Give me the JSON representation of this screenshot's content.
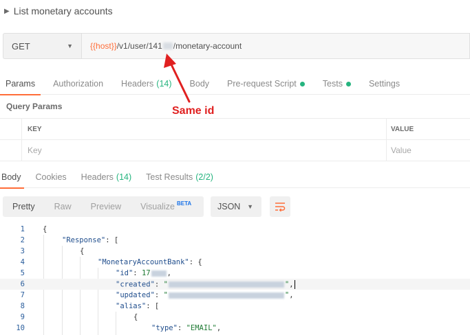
{
  "title": {
    "chevron": "▶",
    "text": "List monetary accounts"
  },
  "request": {
    "method": "GET",
    "url_var": "{{host}}",
    "url_mid": "/v1/user/141",
    "url_end": "/monetary-account"
  },
  "request_tabs": [
    {
      "label": "Params"
    },
    {
      "label": "Authorization"
    },
    {
      "label": "Headers",
      "count": "(14)"
    },
    {
      "label": "Body"
    },
    {
      "label": "Pre-request Script"
    },
    {
      "label": "Tests"
    },
    {
      "label": "Settings"
    }
  ],
  "query_params": {
    "label": "Query Params",
    "col_key": "KEY",
    "col_value": "VALUE",
    "key_placeholder": "Key",
    "value_placeholder": "Value"
  },
  "response_tabs": [
    {
      "label": "Body"
    },
    {
      "label": "Cookies"
    },
    {
      "label": "Headers",
      "count": "(14)"
    },
    {
      "label": "Test Results",
      "count": "(2/2)"
    }
  ],
  "view_modes": {
    "pretty": "Pretty",
    "raw": "Raw",
    "preview": "Preview",
    "visualize": "Visualize",
    "beta": "BETA"
  },
  "format": "JSON",
  "annotation": {
    "text": "Same id",
    "color": "#e02020"
  },
  "code": {
    "line_numbers": [
      "1",
      "2",
      "3",
      "4",
      "5",
      "6",
      "7",
      "8",
      "9",
      "10"
    ],
    "l1": "{",
    "l2_key": "\"Response\"",
    "l2_rest": ": [",
    "l3": "{",
    "l4_key": "\"MonetaryAccountBank\"",
    "l4_rest": ": {",
    "l5_key": "\"id\"",
    "l5_val": "17",
    "l6_key": "\"created\"",
    "l7_key": "\"updated\"",
    "l8_key": "\"alias\"",
    "l8_rest": ": [",
    "l9": "{",
    "l10_key": "\"type\"",
    "l10_val": "\"EMAIL\""
  },
  "colors": {
    "accent": "#ff6c37",
    "green": "#26b47f",
    "annotation_red": "#e02020"
  }
}
